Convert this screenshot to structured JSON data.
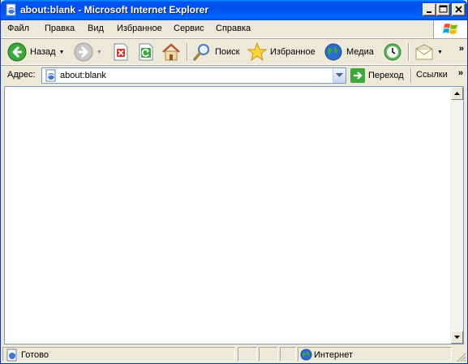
{
  "window": {
    "title": "about:blank - Microsoft Internet Explorer"
  },
  "menu": {
    "items": [
      "Файл",
      "Правка",
      "Вид",
      "Избранное",
      "Сервис",
      "Справка"
    ]
  },
  "toolbar": {
    "back_label": "Назад",
    "search_label": "Поиск",
    "favorites_label": "Избранное",
    "media_label": "Медиа"
  },
  "address": {
    "label": "Адрес:",
    "value": "about:blank",
    "go_label": "Переход",
    "links_label": "Ссылки"
  },
  "status": {
    "text": "Готово",
    "zone": "Интернет"
  },
  "colors": {
    "titlebar": "#0053ee",
    "chrome": "#ece9d8",
    "close_button": "#e04a2a"
  }
}
